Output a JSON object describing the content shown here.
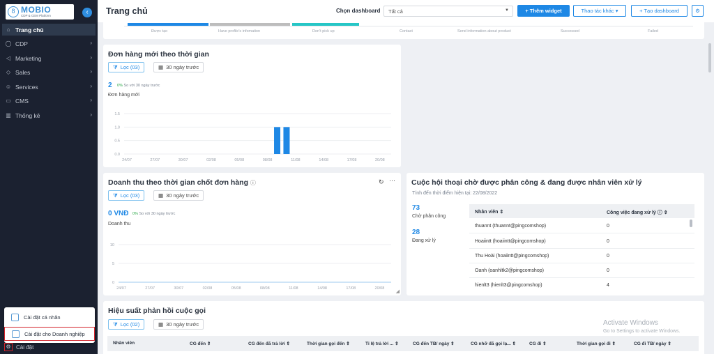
{
  "brand": {
    "name": "MOBIO",
    "tagline": "CDP & CEM Platform"
  },
  "sidebar": {
    "items": [
      {
        "label": "Trang chủ",
        "icon": "home-icon"
      },
      {
        "label": "CDP",
        "icon": "user-icon"
      },
      {
        "label": "Marketing",
        "icon": "megaphone-icon"
      },
      {
        "label": "Sales",
        "icon": "sales-icon"
      },
      {
        "label": "Services",
        "icon": "services-icon"
      },
      {
        "label": "CMS",
        "icon": "cms-icon"
      },
      {
        "label": "Thống kê",
        "icon": "chart-icon"
      }
    ],
    "settings_label": "Cài đặt"
  },
  "settings_menu": {
    "personal": "Cài đặt cá nhân",
    "business": "Cài đặt cho Doanh nghiệp"
  },
  "header": {
    "title": "Trang chủ",
    "dashboard_label": "Chọn dashboard",
    "dashboard_value": "Tất cả",
    "add_widget": "+ Thêm widget",
    "other_actions": "Thao tác khác ▾",
    "create_dashboard": "+ Tạo dashboard"
  },
  "funnel": {
    "labels": [
      "Được tạo",
      "Have profile's infomation",
      "Don't pick up",
      "Contact",
      "Send information about product",
      "Successed",
      "Failed"
    ],
    "colors": [
      "#1e88e5",
      "#bdbdbd",
      "#26c6c6"
    ]
  },
  "orders_card": {
    "title": "Đơn hàng mới theo thời gian",
    "filter": "Lọc (03)",
    "range": "30 ngày trước",
    "kpi": "2",
    "delta_pct": "0%",
    "delta_text": "So với 30 ngày trước",
    "sublabel": "Đơn hàng mới",
    "chart_data": {
      "type": "bar",
      "y_ticks": [
        "1.5",
        "1.0",
        "0.5",
        "0.0"
      ],
      "x_ticks": [
        "24/07",
        "27/07",
        "30/07",
        "02/08",
        "05/08",
        "08/08",
        "11/08",
        "14/08",
        "17/08",
        "20/08"
      ],
      "ylim": [
        0,
        1.5
      ],
      "values": [
        {
          "x": "09/08",
          "y": 1
        },
        {
          "x": "10/08",
          "y": 1
        }
      ]
    }
  },
  "revenue_card": {
    "title": "Doanh thu theo thời gian chốt đơn hàng",
    "filter": "Lọc (03)",
    "range": "30 ngày trước",
    "kpi": "0 VNĐ",
    "delta_pct": "0%",
    "delta_text": "So với 30 ngày trước",
    "sublabel": "Doanh thu",
    "chart_data": {
      "type": "line",
      "y_ticks": [
        "10",
        "5",
        "0"
      ],
      "x_ticks": [
        "24/07",
        "27/07",
        "30/07",
        "02/08",
        "05/08",
        "08/08",
        "11/08",
        "14/08",
        "17/08",
        "20/08"
      ],
      "ylim": [
        0,
        10
      ]
    }
  },
  "conversation_card": {
    "title": "Cuộc hội thoại chờ được phân công & đang được nhân viên xử lý",
    "subtitle": "Tính đến thời điểm hiện tại: 22/08/2022",
    "waiting_count": "73",
    "waiting_label": "Chờ phân công",
    "processing_count": "28",
    "processing_label": "Đang xử lý",
    "columns": [
      "Nhân viên ⇕",
      "Công việc đang xử lý ⓘ ⇕"
    ],
    "rows": [
      {
        "name": "thuannt (thuannt@pingcomshop)",
        "count": "0"
      },
      {
        "name": "Hoaiintt (hoaiintt@pingcomshop)",
        "count": "0"
      },
      {
        "name": "Thu Hoài (hoaiintt@pingcomshop)",
        "count": "0"
      },
      {
        "name": "Oanh (oanhltk2@pingcomshop)",
        "count": "0"
      },
      {
        "name": "hienlt3 (hienlt3@pingcomshop)",
        "count": "4"
      }
    ]
  },
  "call_card": {
    "title": "Hiệu suất phản hồi cuộc gọi",
    "filter": "Lọc (02)",
    "range": "30 ngày trước",
    "columns": [
      "Nhân viên",
      "CG đến ⇕",
      "CG đến đã trả lời ⇕",
      "Thời gian gọi đến ⇕",
      "Tỉ lệ trả lời ... ⇕",
      "CG đến TB/ ngày ⇕",
      "CG nhỡ đã gọi lạ... ⇕",
      "CG đi ⇕",
      "Thời gian gọi đi ⇕",
      "CG đi TB/ ngày ⇕"
    ]
  },
  "watermark": {
    "title": "Activate Windows",
    "text": "Go to Settings to activate Windows."
  }
}
